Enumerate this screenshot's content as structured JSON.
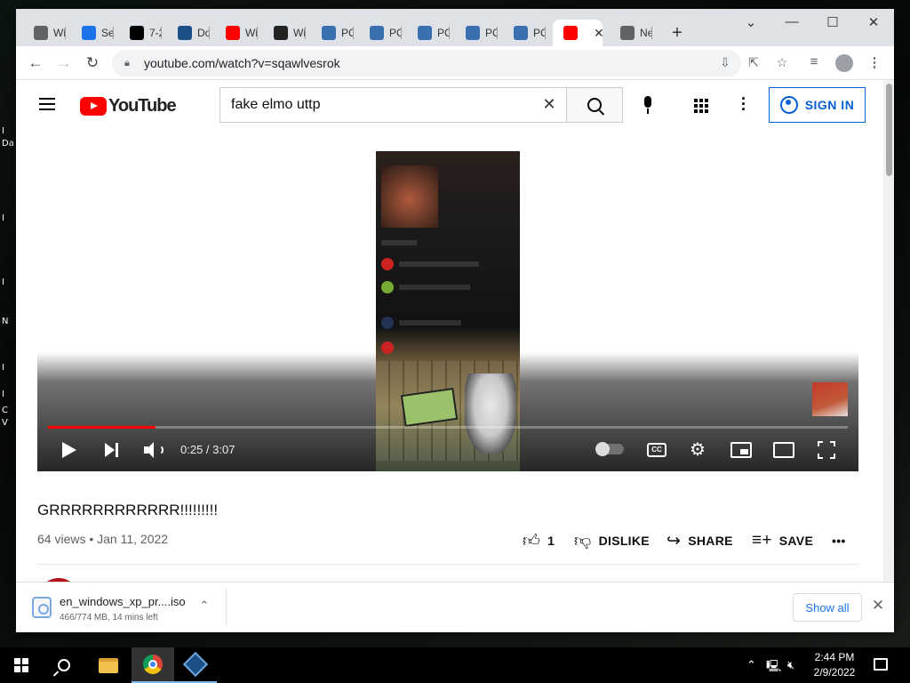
{
  "browser": {
    "tabs": [
      {
        "title": "Wi",
        "icon": "chrome-icon",
        "color": "#5f6368"
      },
      {
        "title": "Se",
        "icon": "gear-icon",
        "color": "#1a73e8"
      },
      {
        "title": "7-2",
        "icon": "7zip-icon",
        "color": "#000000"
      },
      {
        "title": "Do",
        "icon": "virtualbox-icon",
        "color": "#1c4f86"
      },
      {
        "title": "Wi",
        "icon": "youtube-icon",
        "color": "#ff0000"
      },
      {
        "title": "Wi",
        "icon": "wikipedia-icon",
        "color": "#222222"
      },
      {
        "title": "PC",
        "icon": "pcgamingwiki-icon",
        "color": "#3a6fb0"
      },
      {
        "title": "PC",
        "icon": "pcgamingwiki-icon",
        "color": "#3a6fb0"
      },
      {
        "title": "PC",
        "icon": "pcgamingwiki-icon",
        "color": "#3a6fb0"
      },
      {
        "title": "PC",
        "icon": "pcgamingwiki-icon",
        "color": "#3a6fb0"
      },
      {
        "title": "PC",
        "icon": "pcgamingwiki-icon",
        "color": "#3a6fb0"
      },
      {
        "title": "",
        "icon": "youtube-icon",
        "color": "#ff0000",
        "active": true
      },
      {
        "title": "Ne",
        "icon": "chrome-icon",
        "color": "#5f6368"
      }
    ],
    "new_tab": "+",
    "window_controls": {
      "tabsearch": "⌄",
      "minimize": "—",
      "maximize": "☐",
      "close": "✕"
    },
    "url": "youtube.com/watch?v=sqawlvesrok"
  },
  "youtube": {
    "logo_text": "YouTube",
    "search_query": "fake elmo uttp",
    "sign_in": "SIGN IN",
    "player": {
      "current_time": "0:25",
      "duration": "3:07",
      "time_display": "0:25 / 3:07",
      "played_fraction": 0.134,
      "loaded_fraction": 0.134,
      "cc_label": "CC"
    },
    "video_title": "GRRRRRRRRRRRR!!!!!!!!!",
    "views": "64 views",
    "date": "Jan 11, 2022",
    "meta_line": "64 views • Jan 11, 2022",
    "actions": {
      "like_count": "1",
      "dislike": "DISLIKE",
      "share": "SHARE",
      "save": "SAVE",
      "more": "•••"
    }
  },
  "download_shelf": {
    "filename": "en_windows_xp_pr....iso",
    "status": "466/774 MB, 14 mins left",
    "show_all": "Show all"
  },
  "taskbar": {
    "time": "2:44 PM",
    "date": "2/9/2022"
  }
}
